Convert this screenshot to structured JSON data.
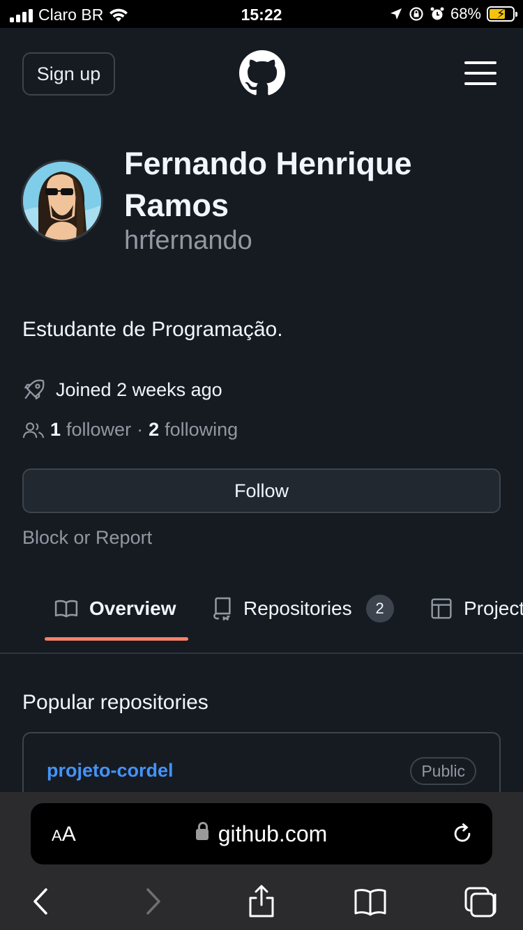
{
  "status_bar": {
    "carrier": "Claro BR",
    "time": "15:22",
    "battery_percent": "68%",
    "battery_level": 0.68
  },
  "header": {
    "signup_label": "Sign up",
    "logo_icon": "github-octocat-icon",
    "menu_icon": "hamburger-menu-icon"
  },
  "profile": {
    "full_name": "Fernando Henrique Ramos",
    "login": "hrfernando",
    "bio": "Estudante de Programação.",
    "joined": "Joined 2 weeks ago",
    "followers_count": "1",
    "followers_label": "follower",
    "separator": "·",
    "following_count": "2",
    "following_label": "following",
    "follow_button": "Follow",
    "block_report": "Block or Report"
  },
  "tabs": [
    {
      "label": "Overview",
      "icon": "book-icon",
      "selected": true
    },
    {
      "label": "Repositories",
      "icon": "repo-icon",
      "count": "2"
    },
    {
      "label": "Projects",
      "icon": "table-icon"
    }
  ],
  "popular": {
    "title": "Popular repositories",
    "repos": [
      {
        "name": "projeto-cordel",
        "visibility": "Public"
      }
    ]
  },
  "safari": {
    "text_size_label_small": "A",
    "text_size_label_large": "A",
    "url": "github.com"
  },
  "colors": {
    "background": "#161b22",
    "accent_underline": "#f78166",
    "link": "#4493f8"
  }
}
